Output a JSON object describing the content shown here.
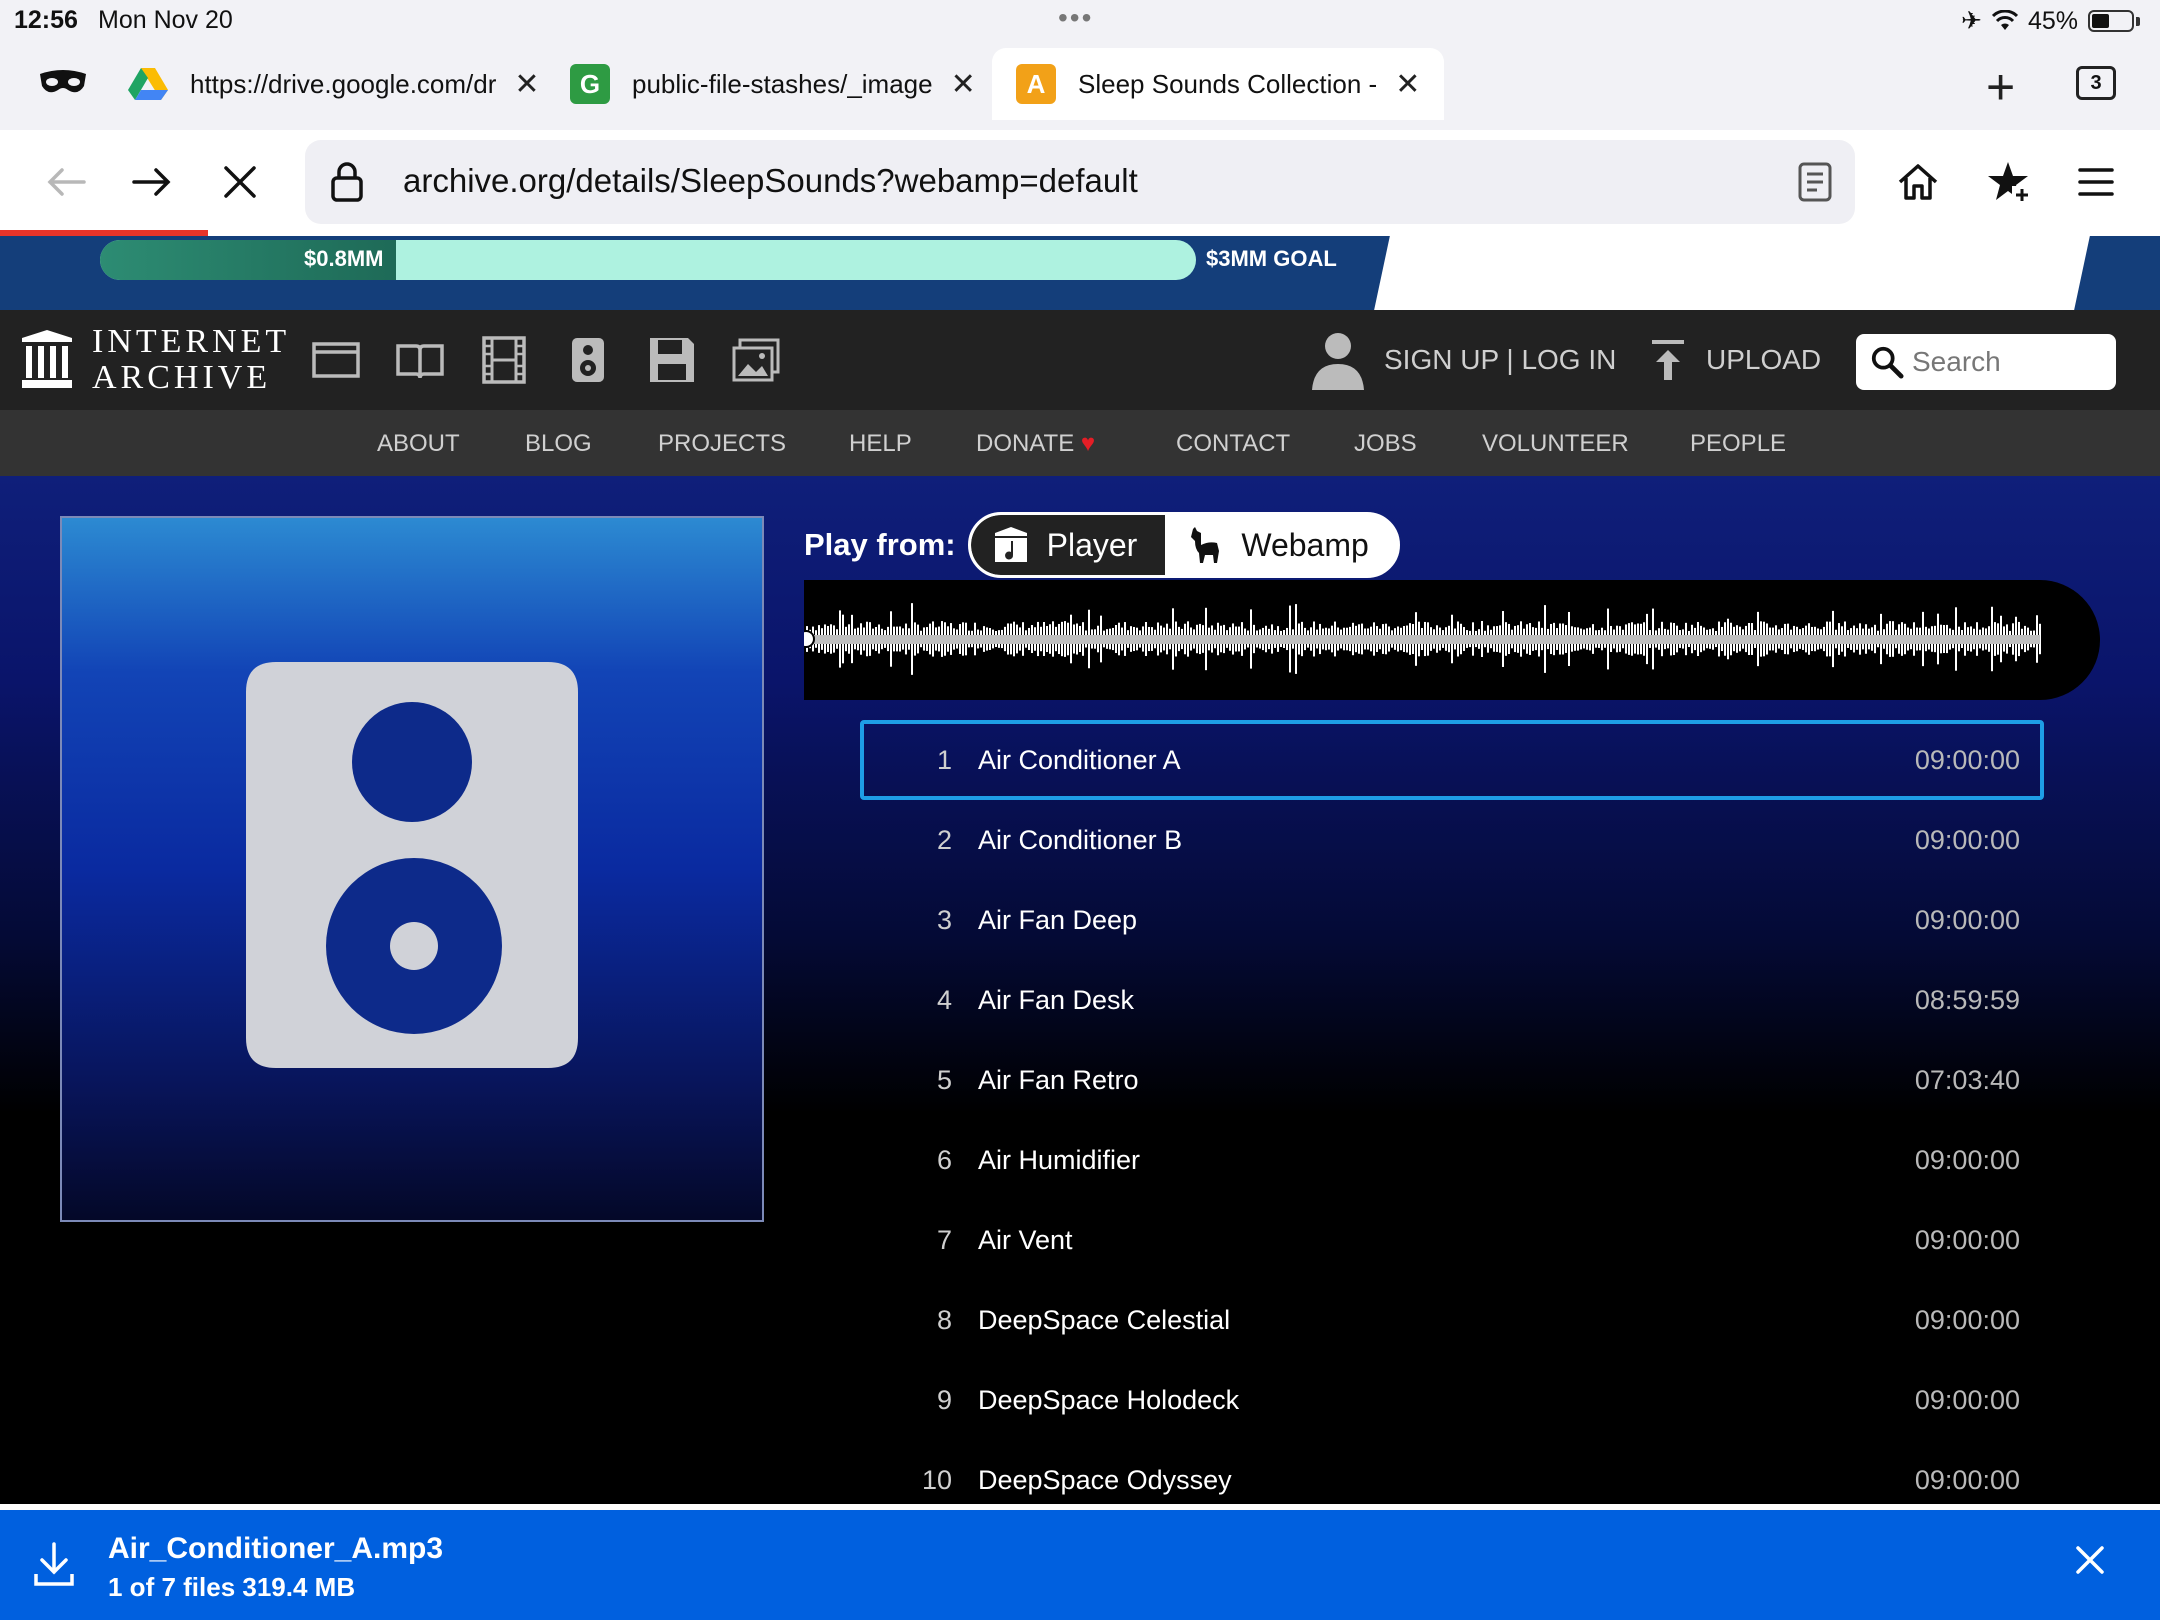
{
  "status": {
    "time": "12:56",
    "date": "Mon Nov 20",
    "battery": "45%"
  },
  "tabs": [
    {
      "label": "https://drive.google.com/dr",
      "favicon": "google-drive-icon",
      "active": false
    },
    {
      "label": "public-file-stashes/_image",
      "favicon": "G",
      "favicon_color": "#2e9b43",
      "active": false
    },
    {
      "label": "Sleep Sounds Collection -",
      "favicon": "A",
      "favicon_color": "#f2a118",
      "active": true
    }
  ],
  "tab_count": "3",
  "toolbar": {
    "url": "archive.org/details/SleepSounds?webamp=default"
  },
  "banner": {
    "raised": "$0.8MM",
    "goal": "$3MM GOAL",
    "progress": 0.27
  },
  "ia": {
    "logo_line1": "INTERNET",
    "logo_line2": "ARCHIVE",
    "signin": "SIGN UP | LOG IN",
    "upload": "UPLOAD",
    "search_placeholder": "Search"
  },
  "subnav": [
    "ABOUT",
    "BLOG",
    "PROJECTS",
    "HELP",
    "DONATE",
    "CONTACT",
    "JOBS",
    "VOLUNTEER",
    "PEOPLE"
  ],
  "player": {
    "play_from_label": "Play from:",
    "options": [
      "Player",
      "Webamp"
    ],
    "selected": "Player"
  },
  "tracks": [
    {
      "num": "1",
      "title": "Air Conditioner A",
      "duration": "09:00:00"
    },
    {
      "num": "2",
      "title": "Air Conditioner B",
      "duration": "09:00:00"
    },
    {
      "num": "3",
      "title": "Air Fan Deep",
      "duration": "09:00:00"
    },
    {
      "num": "4",
      "title": "Air Fan Desk",
      "duration": "08:59:59"
    },
    {
      "num": "5",
      "title": "Air Fan Retro",
      "duration": "07:03:40"
    },
    {
      "num": "6",
      "title": "Air Humidifier",
      "duration": "09:00:00"
    },
    {
      "num": "7",
      "title": "Air Vent",
      "duration": "09:00:00"
    },
    {
      "num": "8",
      "title": "DeepSpace Celestial",
      "duration": "09:00:00"
    },
    {
      "num": "9",
      "title": "DeepSpace Holodeck",
      "duration": "09:00:00"
    },
    {
      "num": "10",
      "title": "DeepSpace Odyssey",
      "duration": "09:00:00"
    }
  ],
  "download": {
    "filename": "Air_Conditioner_A.mp3",
    "info": "1 of 7 files 319.4 MB"
  },
  "colors": {
    "accent": "#0060df",
    "track_highlight": "#1e9ee6",
    "donate_heart": "#e41e26"
  }
}
